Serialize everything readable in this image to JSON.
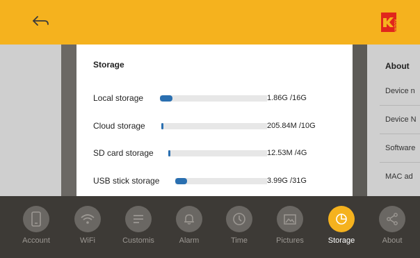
{
  "header": {
    "back_icon": "back-arrow-icon",
    "logo_icon": "kodak-logo-icon",
    "logo_text": "KODAK",
    "accent_color": "#f5b21e"
  },
  "about_panel": {
    "title": "About",
    "items": [
      "Device n",
      "Device N",
      "Software",
      "MAC ad"
    ]
  },
  "storage_dialog": {
    "title": "Storage",
    "rows": [
      {
        "label": "Local storage",
        "value": "1.86G /16G",
        "fill_fraction": 0.116
      },
      {
        "label": "Cloud storage",
        "value": "205.84M /10G",
        "fill_fraction": 0.02
      },
      {
        "label": "SD card storage",
        "value": "12.53M /4G",
        "fill_fraction": 0.003
      },
      {
        "label": "USB stick storage",
        "value": "3.99G /31G",
        "fill_fraction": 0.129
      }
    ],
    "bar_color": "#2a6fb0"
  },
  "nav": {
    "items": [
      {
        "label": "Account",
        "icon": "phone-icon"
      },
      {
        "label": "WiFi",
        "icon": "wifi-icon"
      },
      {
        "label": "Customis",
        "icon": "customize-icon"
      },
      {
        "label": "Alarm",
        "icon": "bell-icon"
      },
      {
        "label": "Time",
        "icon": "clock-icon"
      },
      {
        "label": "Pictures",
        "icon": "pictures-icon"
      },
      {
        "label": "Storage",
        "icon": "pie-chart-icon",
        "active": true
      },
      {
        "label": "About",
        "icon": "share-icon"
      }
    ]
  }
}
